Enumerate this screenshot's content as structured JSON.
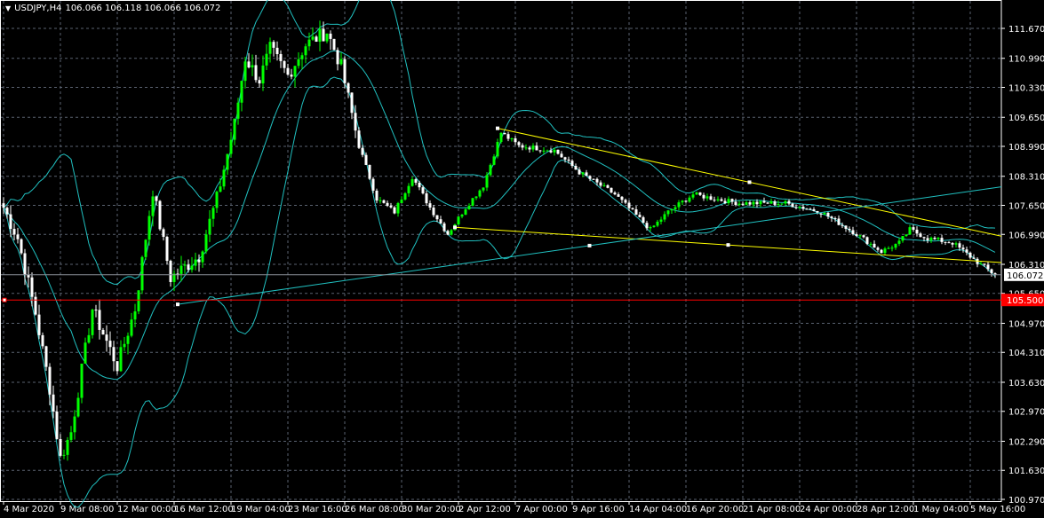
{
  "header": {
    "menu_icon": "triangle-down-icon",
    "symbol": "USDJPY,H4",
    "ohlc": "106.066 106.118 106.066 106.072"
  },
  "chart_data": {
    "type": "candlestick",
    "title": "USDJPY,H4",
    "ylim": [
      100.97,
      111.67
    ],
    "y_ticks": [
      "111.670",
      "110.990",
      "110.330",
      "109.650",
      "108.990",
      "108.310",
      "107.650",
      "106.990",
      "106.310",
      "105.650",
      "104.970",
      "104.310",
      "103.630",
      "102.970",
      "102.290",
      "101.630",
      "100.970"
    ],
    "x_ticks": [
      {
        "label": "4 Mar 2020",
        "bar": 0
      },
      {
        "label": "9 Mar 08:00",
        "bar": 16
      },
      {
        "label": "12 Mar 00:00",
        "bar": 32
      },
      {
        "label": "16 Mar 12:00",
        "bar": 48
      },
      {
        "label": "19 Mar 04:00",
        "bar": 64
      },
      {
        "label": "23 Mar 16:00",
        "bar": 80
      },
      {
        "label": "26 Mar 08:00",
        "bar": 96
      },
      {
        "label": "30 Mar 20:00",
        "bar": 112
      },
      {
        "label": "2 Apr 12:00",
        "bar": 128
      },
      {
        "label": "7 Apr 00:00",
        "bar": 144
      },
      {
        "label": "9 Apr 16:00",
        "bar": 160
      },
      {
        "label": "14 Apr 04:00",
        "bar": 176
      },
      {
        "label": "16 Apr 20:00",
        "bar": 192
      },
      {
        "label": "21 Apr 08:00",
        "bar": 208
      },
      {
        "label": "24 Apr 00:00",
        "bar": 224
      },
      {
        "label": "28 Apr 12:00",
        "bar": 240
      },
      {
        "label": "1 May 04:00",
        "bar": 256
      },
      {
        "label": "5 May 16:00",
        "bar": 272
      }
    ],
    "bar_count": 280,
    "close_path": [
      [
        0,
        107.6
      ],
      [
        4,
        106.9
      ],
      [
        9,
        105.2
      ],
      [
        13,
        103.5
      ],
      [
        16,
        101.9
      ],
      [
        19,
        102.5
      ],
      [
        25,
        105.3
      ],
      [
        32,
        104.0
      ],
      [
        37,
        105.3
      ],
      [
        42,
        108.0
      ],
      [
        47,
        106.0
      ],
      [
        55,
        106.5
      ],
      [
        60,
        107.8
      ],
      [
        65,
        109.5
      ],
      [
        68,
        111.0
      ],
      [
        72,
        110.5
      ],
      [
        75,
        111.2
      ],
      [
        80,
        110.6
      ],
      [
        85,
        111.3
      ],
      [
        91,
        111.6
      ],
      [
        95,
        110.8
      ],
      [
        100,
        109.0
      ],
      [
        105,
        107.8
      ],
      [
        110,
        107.5
      ],
      [
        115,
        108.3
      ],
      [
        120,
        107.6
      ],
      [
        125,
        107.0
      ],
      [
        130,
        107.6
      ],
      [
        135,
        108.1
      ],
      [
        140,
        109.3
      ],
      [
        145,
        109.0
      ],
      [
        155,
        108.9
      ],
      [
        162,
        108.4
      ],
      [
        172,
        107.9
      ],
      [
        182,
        107.1
      ],
      [
        187,
        107.5
      ],
      [
        194,
        107.9
      ],
      [
        200,
        107.8
      ],
      [
        207,
        107.7
      ],
      [
        220,
        107.7
      ],
      [
        230,
        107.5
      ],
      [
        240,
        107.0
      ],
      [
        247,
        106.6
      ],
      [
        252,
        106.8
      ],
      [
        255,
        107.1
      ],
      [
        260,
        106.9
      ],
      [
        267,
        106.8
      ],
      [
        275,
        106.3
      ],
      [
        279,
        106.07
      ]
    ],
    "bollinger": {
      "period": 20,
      "deviations": 2,
      "color": "#20c0c0"
    },
    "trendlines": [
      {
        "name": "upper-wedge",
        "color": "#ffff00",
        "from": [
          139,
          109.4
        ],
        "to": [
          282,
          106.95
        ]
      },
      {
        "name": "lower-wedge",
        "color": "#ffff00",
        "from": [
          127,
          107.15
        ],
        "to": [
          282,
          106.35
        ]
      },
      {
        "name": "support-line",
        "color": "#20c0c0",
        "from": [
          49,
          105.4
        ],
        "to": [
          282,
          108.07
        ]
      }
    ],
    "current_price": {
      "value": 106.072,
      "label": "106.072"
    },
    "level_line": {
      "value": 105.5,
      "label": "105.500",
      "color": "#ff0000"
    },
    "bull_color": "#00ff00",
    "bear_color": "#ffffff"
  }
}
